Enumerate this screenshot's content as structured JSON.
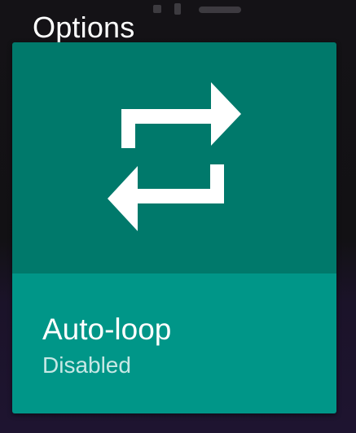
{
  "header": {
    "title": "Options"
  },
  "option_card": {
    "icon": "repeat-icon",
    "title": "Auto-loop",
    "status": "Disabled"
  },
  "colors": {
    "icon_area": "#00796b",
    "text_area": "#009688",
    "background": "#121114"
  }
}
